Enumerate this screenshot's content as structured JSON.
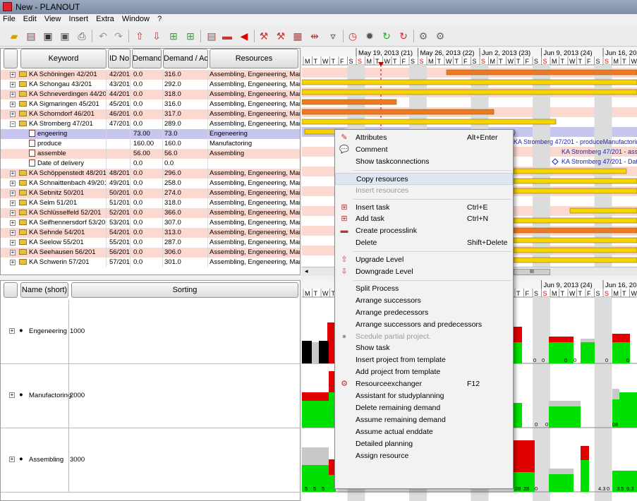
{
  "window": {
    "title": "New - PLANOUT"
  },
  "menu": [
    "File",
    "Edit",
    "View",
    "Insert",
    "Extra",
    "Window",
    "?"
  ],
  "task_table": {
    "columns": [
      "Keyword",
      "ID No",
      "Demand",
      "Demand / Ac...",
      "Resources"
    ],
    "rows": [
      {
        "keyword": "KA Schöningen 42/201",
        "id": "42/201",
        "demand": "0.0",
        "actual": "316.0",
        "resources": "Assembling, Engeneering, Manufa",
        "style": "pink",
        "kind": "project"
      },
      {
        "keyword": "KA Schongau 43/201",
        "id": "43/201",
        "demand": "0.0",
        "actual": "292.0",
        "resources": "Assembling, Engeneering, Manufa",
        "style": "white",
        "kind": "project"
      },
      {
        "keyword": "KA Schneverdingen 44/201",
        "id": "44/201",
        "demand": "0.0",
        "actual": "318.0",
        "resources": "Assembling, Engeneering, Manufa",
        "style": "pink",
        "kind": "project"
      },
      {
        "keyword": "KA Sigmaringen 45/201",
        "id": "45/201",
        "demand": "0.0",
        "actual": "316.0",
        "resources": "Assembling, Engeneering, Manufa",
        "style": "white",
        "kind": "project"
      },
      {
        "keyword": "KA Schorndorf 46/201",
        "id": "46/201",
        "demand": "0.0",
        "actual": "317.0",
        "resources": "Assembling, Engeneering, Manufa",
        "style": "pink",
        "kind": "project"
      },
      {
        "keyword": "KA Stromberg 47/201",
        "id": "47/201",
        "demand": "0.0",
        "actual": "289.0",
        "resources": "Assembling, Engeneering, Manufa",
        "style": "white",
        "kind": "project-open"
      },
      {
        "keyword": "engeering",
        "id": "",
        "demand": "73.00",
        "actual": "73.0",
        "resources": "Engeneering",
        "style": "sel",
        "kind": "task"
      },
      {
        "keyword": "produce",
        "id": "",
        "demand": "160.00",
        "actual": "160.0",
        "resources": "Manufactoring",
        "style": "white",
        "kind": "task"
      },
      {
        "keyword": "assemble",
        "id": "",
        "demand": "56.00",
        "actual": "56.0",
        "resources": "Assembling",
        "style": "pink",
        "kind": "task"
      },
      {
        "keyword": "Date of delivery",
        "id": "",
        "demand": "0.0",
        "actual": "0.0",
        "resources": "",
        "style": "white",
        "kind": "task"
      },
      {
        "keyword": "KA Schöppenstedt 48/201",
        "id": "48/201",
        "demand": "0.0",
        "actual": "296.0",
        "resources": "Assembling, Engeneering, Manufa",
        "style": "pink",
        "kind": "project"
      },
      {
        "keyword": "KA Schnaittenbach 49/201",
        "id": "49/201",
        "demand": "0.0",
        "actual": "258.0",
        "resources": "Assembling, Engeneering, Manufa",
        "style": "white",
        "kind": "project"
      },
      {
        "keyword": "KA Sebnitz 50/201",
        "id": "50/201",
        "demand": "0.0",
        "actual": "274.0",
        "resources": "Assembling, Engeneering, Manufa",
        "style": "pink",
        "kind": "project"
      },
      {
        "keyword": "KA Selm 51/201",
        "id": "51/201",
        "demand": "0.0",
        "actual": "318.0",
        "resources": "Assembling, Engeneering, Manufa",
        "style": "white",
        "kind": "project"
      },
      {
        "keyword": "KA Schlüsselfeld 52/201",
        "id": "52/201",
        "demand": "0.0",
        "actual": "366.0",
        "resources": "Assembling, Engeneering, Manufa",
        "style": "pink",
        "kind": "project"
      },
      {
        "keyword": "KA Seifhennersdorf 53/201",
        "id": "53/201",
        "demand": "0.0",
        "actual": "307.0",
        "resources": "Assembling, Engeneering, Manufa",
        "style": "white",
        "kind": "project"
      },
      {
        "keyword": "KA Sehnde 54/201",
        "id": "54/201",
        "demand": "0.0",
        "actual": "313.0",
        "resources": "Assembling, Engeneering, Manufa",
        "style": "pink",
        "kind": "project"
      },
      {
        "keyword": "KA Seelow 55/201",
        "id": "55/201",
        "demand": "0.0",
        "actual": "287.0",
        "resources": "Assembling, Engeneering, Manufa",
        "style": "white",
        "kind": "project"
      },
      {
        "keyword": "KA Seehausen 56/201",
        "id": "56/201",
        "demand": "0.0",
        "actual": "306.0",
        "resources": "Assembling, Engeneering, Manufa",
        "style": "pink",
        "kind": "project"
      },
      {
        "keyword": "KA Schwerin 57/201",
        "id": "57/201",
        "demand": "0.0",
        "actual": "301.0",
        "resources": "Assembling, Engeneering, Manufa",
        "style": "white",
        "kind": "project"
      }
    ]
  },
  "timeline": {
    "weeks": [
      "May 19, 2013 (21)",
      "May 26, 2013 (22)",
      "Jun 2, 2013 (23)",
      "Jun 9, 2013 (24)",
      "Jun 16, 20"
    ],
    "weeks_lower": [
      "",
      "",
      "(23)",
      "Jun 9, 2013 (24)",
      "Jun 16, 20"
    ],
    "days": [
      "M",
      "T",
      "W",
      "T",
      "F",
      "S",
      "S"
    ]
  },
  "gantt_labels": {
    "row6": "47/201 - .",
    "row6_tail": ")",
    "row7": "KA Stromberg 47/201 - produceManufactoring ( Ma",
    "row8": "KA Stromberg 47/201 - asse",
    "row9": "KA Stromberg 47/201 - Date"
  },
  "resource_table": {
    "columns": [
      "Name (short)",
      "Sorting"
    ],
    "rows": [
      {
        "name": "Engeneering",
        "sorting": "1000"
      },
      {
        "name": "Manufactoring",
        "sorting": "2000"
      },
      {
        "name": "Assembling",
        "sorting": "3000"
      }
    ]
  },
  "capacity_labels": {
    "eng": [
      "0",
      "0",
      "0",
      "0",
      "0",
      "0"
    ],
    "manu": [
      "0",
      "0",
      "08"
    ],
    "asm": [
      "5",
      "5",
      "5",
      "28",
      "28",
      "0",
      "4.3",
      "0",
      "3.5",
      "9.3"
    ]
  },
  "context_menu": [
    {
      "label": "Attributes",
      "shortcut": "Alt+Enter",
      "icon": "attributes-icon",
      "glyph": "✎"
    },
    {
      "label": "Comment",
      "shortcut": "",
      "icon": "comment-icon",
      "glyph": "💬"
    },
    {
      "label": "Show taskconnections",
      "shortcut": "",
      "icon": "",
      "glyph": ""
    },
    {
      "sep": true
    },
    {
      "label": "Copy resources",
      "shortcut": "",
      "icon": "",
      "glyph": "",
      "highlight": true
    },
    {
      "label": "Insert resources",
      "shortcut": "",
      "icon": "",
      "glyph": "",
      "disabled": true
    },
    {
      "sep": true
    },
    {
      "label": "Insert task",
      "shortcut": "Ctrl+E",
      "icon": "insert-task-icon",
      "glyph": "⊞"
    },
    {
      "label": "Add task",
      "shortcut": "Ctrl+N",
      "icon": "add-task-icon",
      "glyph": "⊞"
    },
    {
      "label": "Create processlink",
      "shortcut": "",
      "icon": "processlink-icon",
      "glyph": "▬"
    },
    {
      "label": "Delete",
      "shortcut": "Shift+Delete",
      "icon": "",
      "glyph": ""
    },
    {
      "sep": true
    },
    {
      "label": "Upgrade Level",
      "shortcut": "",
      "icon": "upgrade-level-icon",
      "glyph": "⇧"
    },
    {
      "label": "Downgrade Level",
      "shortcut": "",
      "icon": "downgrade-level-icon",
      "glyph": "⇩"
    },
    {
      "sep": true
    },
    {
      "label": "Split Process",
      "shortcut": "",
      "icon": "",
      "glyph": ""
    },
    {
      "label": "Arrange successors",
      "shortcut": "",
      "icon": "",
      "glyph": ""
    },
    {
      "label": "Arrange predecessors",
      "shortcut": "",
      "icon": "",
      "glyph": ""
    },
    {
      "label": "Arrange successors and predecessors",
      "shortcut": "",
      "icon": "",
      "glyph": ""
    },
    {
      "label": "Scedule partial project.",
      "shortcut": "",
      "icon": "schedule-icon",
      "glyph": "●",
      "disabled": true
    },
    {
      "label": "Show task",
      "shortcut": "",
      "icon": "",
      "glyph": ""
    },
    {
      "label": "Insert project from template",
      "shortcut": "",
      "icon": "",
      "glyph": ""
    },
    {
      "label": "Add project from template",
      "shortcut": "",
      "icon": "",
      "glyph": ""
    },
    {
      "label": "Resourceexchanger",
      "shortcut": "F12",
      "icon": "resourceexchanger-icon",
      "glyph": "⚙"
    },
    {
      "label": "Assistant for studyplanning",
      "shortcut": "",
      "icon": "",
      "glyph": ""
    },
    {
      "label": "Delete remaining demand",
      "shortcut": "",
      "icon": "",
      "glyph": ""
    },
    {
      "label": "Assume remaining demand",
      "shortcut": "",
      "icon": "",
      "glyph": ""
    },
    {
      "label": "Assume actual enddate",
      "shortcut": "",
      "icon": "",
      "glyph": ""
    },
    {
      "label": "Detailed planning",
      "shortcut": "",
      "icon": "",
      "glyph": ""
    },
    {
      "label": "Assign resource",
      "shortcut": "",
      "icon": "",
      "glyph": ""
    }
  ],
  "colors": {
    "bar_yellow": "#f5d400",
    "bar_orange": "#f07820",
    "cap_green": "#00e000",
    "cap_red": "#e00000",
    "cap_gray": "#c8c8c8",
    "row_pink": "#fbd9d0",
    "row_selected": "#c6c6ee"
  }
}
